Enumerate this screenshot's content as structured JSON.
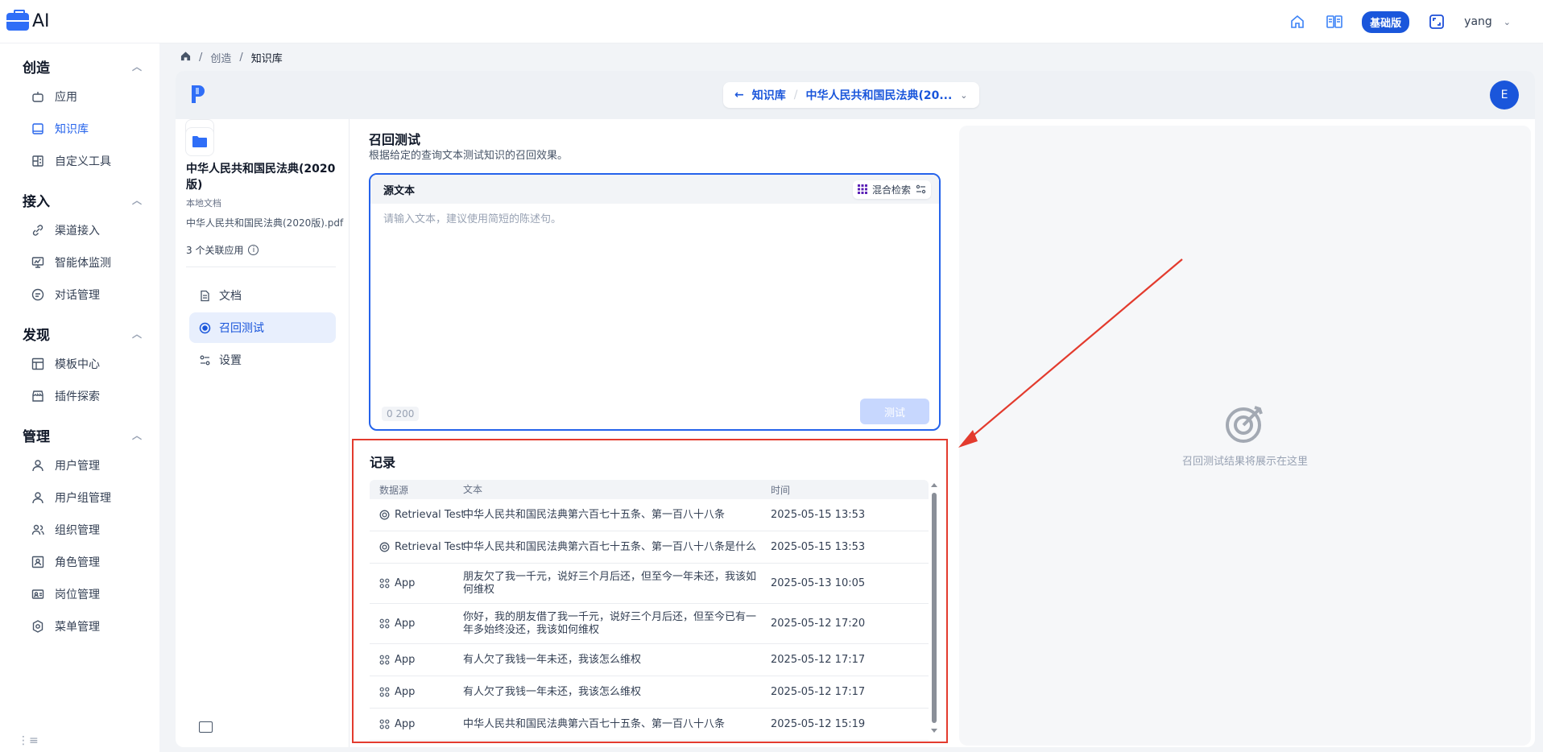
{
  "app": {
    "logo_text": "AI"
  },
  "header": {
    "plan_badge": "基础版",
    "user": "yang"
  },
  "sidebar": {
    "groups": [
      {
        "title": "创造",
        "items": [
          {
            "label": "应用",
            "icon": "robot-icon"
          },
          {
            "label": "知识库",
            "icon": "book-icon",
            "active": true
          },
          {
            "label": "自定义工具",
            "icon": "toolbox-icon"
          }
        ]
      },
      {
        "title": "接入",
        "items": [
          {
            "label": "渠道接入",
            "icon": "link-icon"
          },
          {
            "label": "智能体监测",
            "icon": "monitor-icon"
          },
          {
            "label": "对话管理",
            "icon": "chat-icon"
          }
        ]
      },
      {
        "title": "发现",
        "items": [
          {
            "label": "模板中心",
            "icon": "template-icon"
          },
          {
            "label": "插件探索",
            "icon": "store-icon"
          }
        ]
      },
      {
        "title": "管理",
        "items": [
          {
            "label": "用户管理",
            "icon": "user-icon"
          },
          {
            "label": "用户组管理",
            "icon": "user-group-icon"
          },
          {
            "label": "组织管理",
            "icon": "org-icon"
          },
          {
            "label": "角色管理",
            "icon": "role-icon"
          },
          {
            "label": "岗位管理",
            "icon": "post-icon"
          },
          {
            "label": "菜单管理",
            "icon": "menu-gear-icon"
          }
        ]
      }
    ]
  },
  "breadcrumb": {
    "items": [
      "创造",
      "知识库"
    ]
  },
  "kb_header": {
    "back_label": "知识库",
    "kb_title": "中华人民共和国民法典(20...",
    "avatar_letter": "E"
  },
  "kb_info": {
    "name": "中华人民共和国民法典(2020版)",
    "type": "本地文档",
    "file": "中华人民共和国民法典(2020版).pdf",
    "apps": "3 个关联应用"
  },
  "kb_nav": [
    {
      "label": "文档",
      "icon": "document-icon"
    },
    {
      "label": "召回测试",
      "icon": "target-icon",
      "active": true
    },
    {
      "label": "设置",
      "icon": "settings-icon"
    }
  ],
  "test": {
    "title": "召回测试",
    "desc": "根据给定的查询文本测试知识的召回效果。",
    "source_label": "源文本",
    "mode_label": "混合检索",
    "placeholder": "请输入文本，建议使用简短的陈述句。",
    "counter_current": "0",
    "counter_max": "200",
    "button": "测试"
  },
  "records": {
    "title": "记录",
    "columns": [
      "数据源",
      "文本",
      "时间"
    ],
    "rows": [
      {
        "source": "Retrieval Test",
        "kind": "retrieval",
        "text": "中华人民共和国民法典第六百七十五条、第一百八十八条",
        "time": "2025-05-15 13:53"
      },
      {
        "source": "Retrieval Test",
        "kind": "retrieval",
        "text": "中华人民共和国民法典第六百七十五条、第一百八十八条是什么",
        "time": "2025-05-15 13:53"
      },
      {
        "source": "App",
        "kind": "app",
        "text": "朋友欠了我一千元，说好三个月后还，但至今一年未还，我该如何维权",
        "time": "2025-05-13 10:05"
      },
      {
        "source": "App",
        "kind": "app",
        "text": "你好，我的朋友借了我一千元，说好三个月后还，但至今已有一年多始终没还，我该如何维权",
        "time": "2025-05-12 17:20"
      },
      {
        "source": "App",
        "kind": "app",
        "text": "有人欠了我钱一年未还，我该怎么维权",
        "time": "2025-05-12 17:17"
      },
      {
        "source": "App",
        "kind": "app",
        "text": "有人欠了我钱一年未还，我该怎么维权",
        "time": "2025-05-12 17:17"
      },
      {
        "source": "App",
        "kind": "app",
        "text": "中华人民共和国民法典第六百七十五条、第一百八十八条",
        "time": "2025-05-12 15:19"
      }
    ]
  },
  "result": {
    "empty_text": "召回测试结果将展示在这里"
  },
  "colors": {
    "accent": "#1a56db",
    "highlight_frame": "#e33b2e"
  }
}
